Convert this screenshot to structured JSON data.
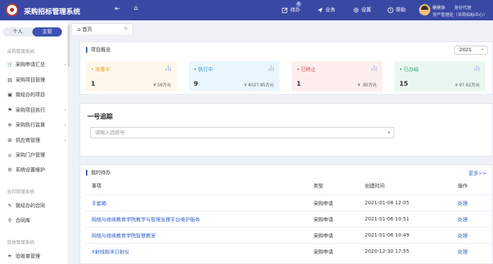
{
  "app": {
    "title": "采购招标管理系统"
  },
  "topbar": {
    "todo_label": "待办",
    "todo_count": "4",
    "business_label": "业务",
    "settings_label": "设置",
    "help_label": "帮助",
    "user_name": "鼎鼎协",
    "user_role": "身份代理",
    "user_org": "资产管理处（采购招标中心）"
  },
  "sidebar": {
    "switch": {
      "personal": "个人",
      "main": "主管"
    },
    "sections": [
      {
        "title": "采购管理系统",
        "items": [
          {
            "label": "采购申请汇总",
            "icon": "cart-icon",
            "chevron": true
          },
          {
            "label": "采购项目管理",
            "icon": "list-icon",
            "chevron": false
          },
          {
            "label": "我经办的项目",
            "icon": "doc-icon",
            "chevron": false
          },
          {
            "label": "采购项目执行",
            "icon": "exec-icon",
            "chevron": true
          },
          {
            "label": "采购执行监督",
            "icon": "monitor-icon",
            "chevron": true
          },
          {
            "label": "供应商管理",
            "icon": "supplier-icon",
            "chevron": true
          },
          {
            "label": "采购门户管理",
            "icon": "home-icon",
            "chevron": false
          },
          {
            "label": "系统设置维护",
            "icon": "gear-icon",
            "chevron": false
          }
        ]
      },
      {
        "title": "合同管理系统",
        "items": [
          {
            "label": "我经办的合同",
            "icon": "edit-icon",
            "chevron": false
          },
          {
            "label": "合同库",
            "icon": "search-icon",
            "chevron": false
          }
        ]
      },
      {
        "title": "验收管理系统",
        "items": [
          {
            "label": "验收单管理",
            "icon": "pen-icon",
            "chevron": false
          }
        ]
      }
    ]
  },
  "tabs": {
    "home": "首页"
  },
  "overview": {
    "title": "项目概览",
    "year": "2021",
    "stats": [
      {
        "label": "准备中",
        "count": "1",
        "amount": "¥ 58万元",
        "color": "#e8a317",
        "bg": "#fff8ea"
      },
      {
        "label": "执行中",
        "count": "9",
        "amount": "¥ 4027.85万元",
        "color": "#2e93c8",
        "bg": "#eaf6fd"
      },
      {
        "label": "已终止",
        "count": "1",
        "amount": "¥ .95万元",
        "color": "#d9363e",
        "bg": "#fdeeee"
      },
      {
        "label": "已办结",
        "count": "15",
        "amount": "¥ 97.62万元",
        "color": "#2ea36a",
        "bg": "#eaf7f0"
      }
    ]
  },
  "tracking": {
    "title": "一号追踪",
    "placeholder": "请输入追踪号"
  },
  "todo": {
    "title": "我的待办",
    "more": "更多>>",
    "headers": [
      "事项",
      "类型",
      "创建时间",
      "操作"
    ],
    "rows": [
      {
        "item": "手套箱",
        "type": "采购申请",
        "time": "2021-01-08 12:05",
        "action": "处理"
      },
      {
        "item": "网络与继续教育学院教学与管理支撑平台维护服务",
        "type": "采购申请",
        "time": "2021-01-06 10:51",
        "action": "处理"
      },
      {
        "item": "网络与继续教育学院智慧教室",
        "type": "采购申请",
        "time": "2021-01-06 10:49",
        "action": "处理"
      },
      {
        "item": "X射线粉末衍射仪",
        "type": "采购申请",
        "time": "2020-12-30 17:55",
        "action": "处理"
      }
    ]
  }
}
